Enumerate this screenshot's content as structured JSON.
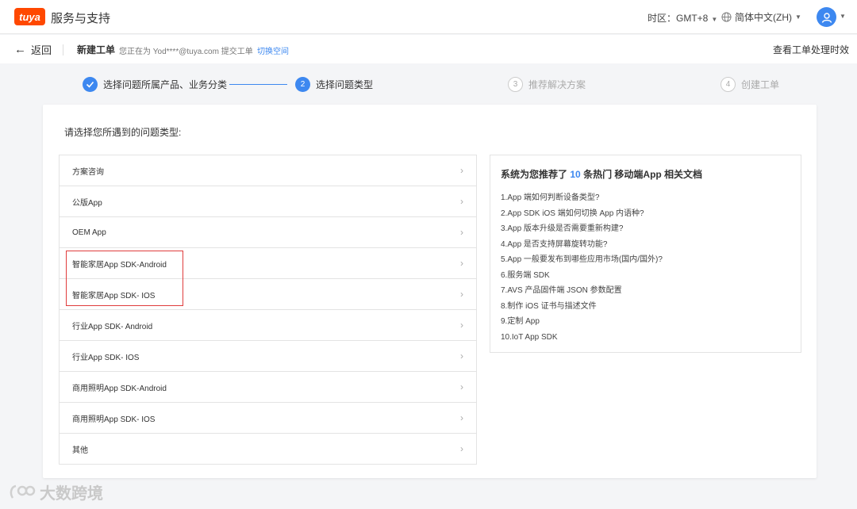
{
  "header": {
    "logo_text": "tuya",
    "site_title": "服务与支持",
    "timezone_label": "时区：",
    "timezone_value": "GMT+8",
    "language": "简体中文(ZH)",
    "icons": {
      "globe": "globe-icon",
      "avatar": "user-icon",
      "dropdown": "caret-down-icon"
    }
  },
  "subheader": {
    "back_label": "返回",
    "page_title": "新建工单",
    "user_note": "您正在为 Yod****@tuya.com 提交工单",
    "switch_space": "切换空间",
    "sla_link": "查看工单处理时效"
  },
  "steps": [
    {
      "index": "1",
      "label": "选择问题所属产品、业务分类",
      "state": "done"
    },
    {
      "index": "2",
      "label": "选择问题类型",
      "state": "active"
    },
    {
      "index": "3",
      "label": "推荐解决方案",
      "state": "todo"
    },
    {
      "index": "4",
      "label": "创建工单",
      "state": "todo"
    }
  ],
  "main": {
    "prompt": "请选择您所遇到的问题类型:",
    "problem_types": [
      "方案咨询",
      "公版App",
      "OEM App",
      "智能家居App SDK-Android",
      "智能家居App SDK- IOS",
      "行业App SDK- Android",
      "行业App SDK- IOS",
      "商用照明App SDK-Android",
      "商用照明App SDK- IOS",
      "其他"
    ],
    "docs": {
      "title_prefix": "系统为您推荐了",
      "count": "10",
      "title_suffix": "条热门 移动端App 相关文档",
      "items": [
        "1.App 端如何判断设备类型?",
        "2.App SDK iOS 端如何切换 App 内语种?",
        "3.App 版本升级是否需要重新构建?",
        "4.App 是否支持屏幕旋转功能?",
        "5.App 一般要发布到哪些应用市场(国内/国外)?",
        "6.服务端 SDK",
        "7.AVS 产品固件端 JSON 参数配置",
        "8.制作 iOS 证书与描述文件",
        "9.定制 App",
        "10.IoT App SDK"
      ]
    }
  },
  "watermark": "大数跨境",
  "colors": {
    "accent": "#3d88f0",
    "brand": "#ff4800",
    "highlight": "#e03c3c"
  }
}
